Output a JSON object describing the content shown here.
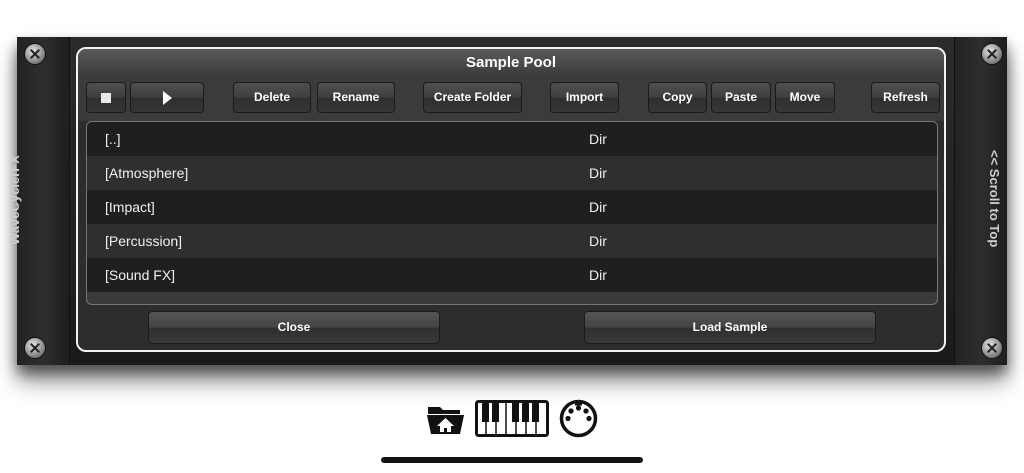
{
  "rack": {
    "left_label": "WaveCyclerFX",
    "right_label": "<< Scroll to Top"
  },
  "dialog": {
    "title": "Sample Pool"
  },
  "toolbar": {
    "delete": "Delete",
    "rename": "Rename",
    "create_folder": "Create Folder",
    "import": "Import",
    "copy": "Copy",
    "paste": "Paste",
    "move": "Move",
    "refresh": "Refresh",
    "stop_icon": "stop-icon",
    "play_icon": "play-icon"
  },
  "list": {
    "rows": [
      {
        "name": "[..]",
        "type": "Dir"
      },
      {
        "name": "[Atmosphere]",
        "type": "Dir"
      },
      {
        "name": "[Impact]",
        "type": "Dir"
      },
      {
        "name": "[Percussion]",
        "type": "Dir"
      },
      {
        "name": "[Sound FX]",
        "type": "Dir"
      }
    ]
  },
  "footer": {
    "close": "Close",
    "load_sample": "Load Sample"
  },
  "bottom_icons": [
    "folder-home-icon",
    "keyboard-icon",
    "midi-icon"
  ]
}
